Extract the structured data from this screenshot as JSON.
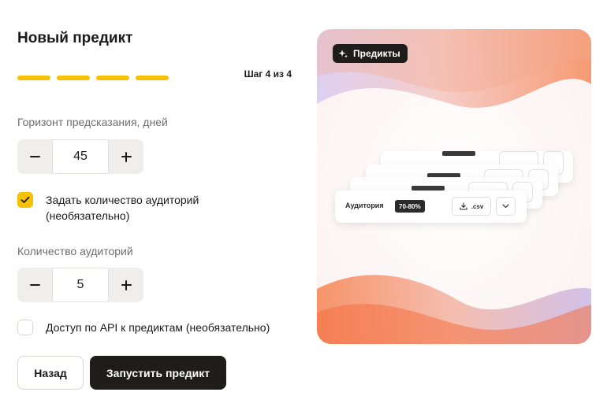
{
  "form": {
    "title": "Новый предикт",
    "step_label": "Шаг 4 из 4",
    "steps_total": 4,
    "steps_completed": 4,
    "accent_color": "#f6c100",
    "horizon": {
      "label": "Горизонт предсказания, дней",
      "value": "45"
    },
    "set_audiences": {
      "label": "Задать количество аудиторий (необязательно)",
      "checked": true
    },
    "audience_count": {
      "label": "Количество аудиторий",
      "value": "5"
    },
    "api_access": {
      "label": "Доступ по API к предиктам (необязательно)",
      "checked": false
    },
    "buttons": {
      "back": "Назад",
      "run": "Запустить предикт"
    }
  },
  "promo": {
    "pill_label": "Предикты",
    "pill_icon": "sparkle-icon",
    "card": {
      "audience_label": "Аудитория",
      "range_badge": "70-80%",
      "download_label": ".csv",
      "download_icon": "download-icon",
      "dropdown_icon": "chevron-down-icon"
    }
  }
}
